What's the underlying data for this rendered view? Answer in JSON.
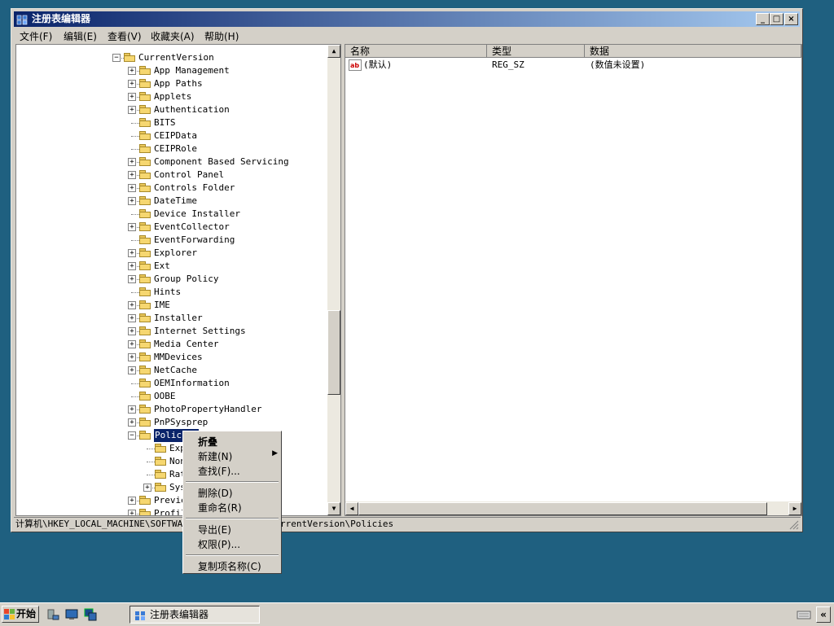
{
  "window": {
    "title": "注册表编辑器",
    "buttons": [
      "_",
      "□",
      "×"
    ]
  },
  "menu": [
    "文件(F)",
    "编辑(E)",
    "查看(V)",
    "收藏夹(A)",
    "帮助(H)"
  ],
  "tree": {
    "items": [
      {
        "label": "CurrentVersion",
        "expander": "-"
      },
      {
        "label": "App Management",
        "expander": "+"
      },
      {
        "label": "App Paths",
        "expander": "+"
      },
      {
        "label": "Applets",
        "expander": "+"
      },
      {
        "label": "Authentication",
        "expander": "+"
      },
      {
        "label": "BITS",
        "expander": ""
      },
      {
        "label": "CEIPData",
        "expander": ""
      },
      {
        "label": "CEIPRole",
        "expander": ""
      },
      {
        "label": "Component Based Servicing",
        "expander": "+"
      },
      {
        "label": "Control Panel",
        "expander": "+"
      },
      {
        "label": "Controls Folder",
        "expander": "+"
      },
      {
        "label": "DateTime",
        "expander": "+"
      },
      {
        "label": "Device Installer",
        "expander": ""
      },
      {
        "label": "EventCollector",
        "expander": "+"
      },
      {
        "label": "EventForwarding",
        "expander": ""
      },
      {
        "label": "Explorer",
        "expander": "+"
      },
      {
        "label": "Ext",
        "expander": "+"
      },
      {
        "label": "Group Policy",
        "expander": "+"
      },
      {
        "label": "Hints",
        "expander": ""
      },
      {
        "label": "IME",
        "expander": "+"
      },
      {
        "label": "Installer",
        "expander": "+"
      },
      {
        "label": "Internet Settings",
        "expander": "+"
      },
      {
        "label": "Media Center",
        "expander": "+"
      },
      {
        "label": "MMDevices",
        "expander": "+"
      },
      {
        "label": "NetCache",
        "expander": "+"
      },
      {
        "label": "OEMInformation",
        "expander": ""
      },
      {
        "label": "OOBE",
        "expander": ""
      },
      {
        "label": "PhotoPropertyHandler",
        "expander": "+"
      },
      {
        "label": "PnPSysprep",
        "expander": "+"
      },
      {
        "label": "Policies",
        "expander": "-",
        "selected": true
      },
      {
        "label": "Explo",
        "expander": ""
      },
      {
        "label": "NonEn",
        "expander": ""
      },
      {
        "label": "Ratin",
        "expander": ""
      },
      {
        "label": "Syste",
        "expander": "+"
      },
      {
        "label": "PreviewH",
        "expander": "+"
      },
      {
        "label": "ProfileN",
        "expander": "+"
      }
    ]
  },
  "list": {
    "columns": [
      "名称",
      "类型",
      "数据"
    ],
    "rows": [
      {
        "name": "(默认)",
        "type": "REG_SZ",
        "data": "(数值未设置)"
      }
    ]
  },
  "status": {
    "path_left": "计算机\\HKEY_LOCAL_MACHINE\\SOFTWARE",
    "path_right": "rrentVersion\\Policies"
  },
  "context_menu": {
    "items": [
      {
        "label": "折叠",
        "bold": true
      },
      {
        "label": "新建(N)",
        "submenu": true
      },
      {
        "label": "查找(F)..."
      },
      {
        "label": "删除(D)"
      },
      {
        "label": "重命名(R)"
      },
      {
        "label": "导出(E)"
      },
      {
        "label": "权限(P)..."
      },
      {
        "label": "复制项名称(C)"
      }
    ]
  },
  "taskbar": {
    "start_label": "开始",
    "task_label": "注册表编辑器"
  }
}
